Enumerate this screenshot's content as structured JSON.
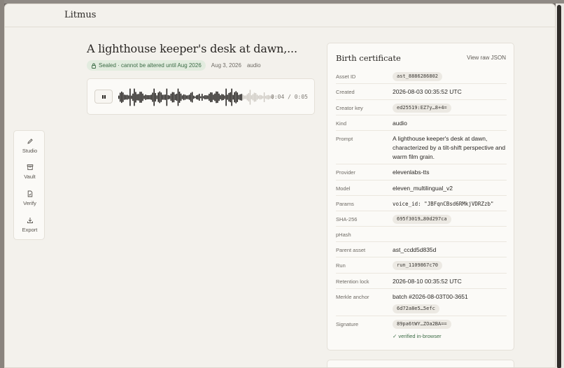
{
  "app": {
    "brand": "Litmus"
  },
  "asset": {
    "title": "A lighthouse keeper's desk at dawn,...",
    "sealed_label": "Sealed · cannot be altered until Aug 2026",
    "date": "Aug 3, 2026",
    "kind": "audio"
  },
  "player": {
    "time": "0:04 / 0:05",
    "state_icon": "pause-icon",
    "progress": 0.8
  },
  "sidebar": {
    "items": [
      {
        "label": "Studio",
        "icon": "pencil-icon"
      },
      {
        "label": "Vault",
        "icon": "archive-icon"
      },
      {
        "label": "Verify",
        "icon": "file-check-icon"
      },
      {
        "label": "Export",
        "icon": "download-icon"
      }
    ]
  },
  "certificate": {
    "title": "Birth certificate",
    "raw_link": "View raw JSON",
    "rows": [
      {
        "key": "Asset ID",
        "value": "ast_8886286802",
        "chip": true
      },
      {
        "key": "Created",
        "value": "2026-08-03 00:35:52 UTC",
        "chip": false
      },
      {
        "key": "Creator key",
        "value": "ed25519:EZ7y…8+4=",
        "chip": true
      },
      {
        "key": "Kind",
        "value": "audio",
        "chip": false
      },
      {
        "key": "Prompt",
        "value": "A lighthouse keeper's desk at dawn, characterized by a tilt-shift perspective and warm film grain.",
        "chip": false
      },
      {
        "key": "Provider",
        "value": "elevenlabs-tts",
        "chip": false
      },
      {
        "key": "Model",
        "value": "eleven_multilingual_v2",
        "chip": false
      },
      {
        "key": "Params",
        "value": "voice_id: \"JBFqnCBsd6RMkjVDRZzb\"",
        "chip": false,
        "mono": true
      },
      {
        "key": "SHA-256",
        "value": "695f3019…80d297ca",
        "chip": true
      },
      {
        "key": "pHash",
        "value": "",
        "chip": false
      },
      {
        "key": "Parent asset",
        "value": "ast_ccdd5d835d",
        "chip": false
      },
      {
        "key": "Run",
        "value": "run_1109867c70",
        "chip": true
      },
      {
        "key": "Retention lock",
        "value": "2026-08-10 00:35:52 UTC",
        "chip": false
      },
      {
        "key": "Merkle anchor",
        "value": "batch #2026-08-03T00-3651",
        "value2": "6d72a8e5…5efc",
        "chip": false
      },
      {
        "key": "Signature",
        "value": "89pa6tWY…ZOa2BA==",
        "verified": "✓ verified in-browser",
        "chip": true
      }
    ]
  },
  "colors": {
    "accent_green": "#3b6b45",
    "badge_bg": "#e2ecdf",
    "background": "#f3f1ec"
  }
}
